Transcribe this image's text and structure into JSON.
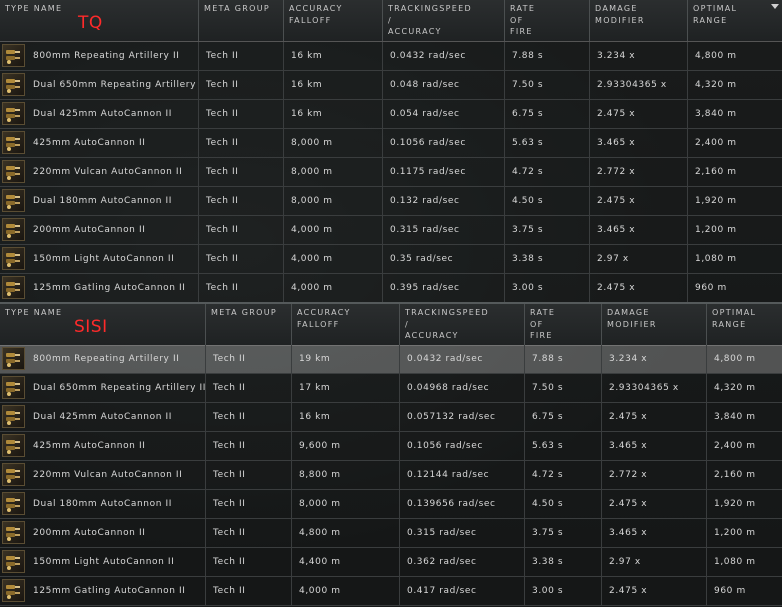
{
  "tables": [
    {
      "tag": "TQ",
      "headers": [
        [
          "TYPE NAME"
        ],
        [
          "META GROUP"
        ],
        [
          "ACCURACY",
          "FALLOFF"
        ],
        [
          "TRACKINGSPEED",
          "/",
          "ACCURACY"
        ],
        [
          "RATE",
          "OF",
          "FIRE"
        ],
        [
          "DAMAGE",
          "MODIFIER"
        ],
        [
          "OPTIMAL",
          "RANGE"
        ]
      ],
      "rows": [
        {
          "icon": "autocannon-ammo-icon",
          "name": "800mm Repeating Artillery II",
          "meta": "Tech II",
          "falloff": "16 km",
          "tracking": "0.0432 rad/sec",
          "rof": "7.88 s",
          "dmg": "3.234 x",
          "range": "4,800 m"
        },
        {
          "icon": "autocannon-ammo-icon",
          "name": "Dual 650mm Repeating Artillery",
          "meta": "Tech II",
          "falloff": "16 km",
          "tracking": "0.048 rad/sec",
          "rof": "7.50 s",
          "dmg": "2.93304365 x",
          "range": "4,320 m"
        },
        {
          "icon": "autocannon-ammo-icon",
          "name": "Dual 425mm AutoCannon II",
          "meta": "Tech II",
          "falloff": "16 km",
          "tracking": "0.054 rad/sec",
          "rof": "6.75 s",
          "dmg": "2.475 x",
          "range": "3,840 m"
        },
        {
          "icon": "autocannon-ammo-icon",
          "name": "425mm AutoCannon II",
          "meta": "Tech II",
          "falloff": "8,000 m",
          "tracking": "0.1056 rad/sec",
          "rof": "5.63 s",
          "dmg": "3.465 x",
          "range": "2,400 m"
        },
        {
          "icon": "autocannon-ammo-icon",
          "name": "220mm Vulcan AutoCannon II",
          "meta": "Tech II",
          "falloff": "8,000 m",
          "tracking": "0.1175 rad/sec",
          "rof": "4.72 s",
          "dmg": "2.772 x",
          "range": "2,160 m"
        },
        {
          "icon": "autocannon-ammo-icon",
          "name": "Dual 180mm AutoCannon II",
          "meta": "Tech II",
          "falloff": "8,000 m",
          "tracking": "0.132 rad/sec",
          "rof": "4.50 s",
          "dmg": "2.475 x",
          "range": "1,920 m"
        },
        {
          "icon": "autocannon-ammo-icon",
          "name": "200mm AutoCannon II",
          "meta": "Tech II",
          "falloff": "4,000 m",
          "tracking": "0.315 rad/sec",
          "rof": "3.75 s",
          "dmg": "3.465 x",
          "range": "1,200 m"
        },
        {
          "icon": "autocannon-ammo-icon",
          "name": "150mm Light AutoCannon II",
          "meta": "Tech II",
          "falloff": "4,000 m",
          "tracking": "0.35 rad/sec",
          "rof": "3.38 s",
          "dmg": "2.97 x",
          "range": "1,080 m"
        },
        {
          "icon": "autocannon-ammo-icon",
          "name": "125mm Gatling AutoCannon II",
          "meta": "Tech II",
          "falloff": "4,000 m",
          "tracking": "0.395 rad/sec",
          "rof": "3.00 s",
          "dmg": "2.475 x",
          "range": "960 m"
        }
      ]
    },
    {
      "tag": "SISI",
      "headers": [
        [
          "TYPE NAME"
        ],
        [
          "META GROUP"
        ],
        [
          "ACCURACY",
          "FALLOFF"
        ],
        [
          "TRACKINGSPEED",
          "/",
          "ACCURACY"
        ],
        [
          "RATE",
          "OF",
          "FIRE"
        ],
        [
          "DAMAGE",
          "MODIFIER"
        ],
        [
          "OPTIMAL",
          "RANGE"
        ]
      ],
      "rows": [
        {
          "icon": "autocannon-ammo-icon",
          "name": "800mm Repeating Artillery II",
          "meta": "Tech II",
          "falloff": "19 km",
          "tracking": "0.0432 rad/sec",
          "rof": "7.88 s",
          "dmg": "3.234 x",
          "range": "4,800 m"
        },
        {
          "icon": "autocannon-ammo-icon",
          "name": "Dual 650mm Repeating Artillery II",
          "meta": "Tech II",
          "falloff": "17 km",
          "tracking": "0.04968 rad/sec",
          "rof": "7.50 s",
          "dmg": "2.93304365 x",
          "range": "4,320 m"
        },
        {
          "icon": "autocannon-ammo-icon",
          "name": "Dual 425mm AutoCannon II",
          "meta": "Tech II",
          "falloff": "16 km",
          "tracking": "0.057132 rad/sec",
          "rof": "6.75 s",
          "dmg": "2.475 x",
          "range": "3,840 m"
        },
        {
          "icon": "autocannon-ammo-icon",
          "name": "425mm AutoCannon II",
          "meta": "Tech II",
          "falloff": "9,600 m",
          "tracking": "0.1056 rad/sec",
          "rof": "5.63 s",
          "dmg": "3.465 x",
          "range": "2,400 m"
        },
        {
          "icon": "autocannon-ammo-icon",
          "name": "220mm Vulcan AutoCannon II",
          "meta": "Tech II",
          "falloff": "8,800 m",
          "tracking": "0.12144 rad/sec",
          "rof": "4.72 s",
          "dmg": "2.772 x",
          "range": "2,160 m"
        },
        {
          "icon": "autocannon-ammo-icon",
          "name": "Dual 180mm AutoCannon II",
          "meta": "Tech II",
          "falloff": "8,000 m",
          "tracking": "0.139656 rad/sec",
          "rof": "4.50 s",
          "dmg": "2.475 x",
          "range": "1,920 m"
        },
        {
          "icon": "autocannon-ammo-icon",
          "name": "200mm AutoCannon II",
          "meta": "Tech II",
          "falloff": "4,800 m",
          "tracking": "0.315 rad/sec",
          "rof": "3.75 s",
          "dmg": "3.465 x",
          "range": "1,200 m"
        },
        {
          "icon": "autocannon-ammo-icon",
          "name": "150mm Light AutoCannon II",
          "meta": "Tech II",
          "falloff": "4,400 m",
          "tracking": "0.362 rad/sec",
          "rof": "3.38 s",
          "dmg": "2.97 x",
          "range": "1,080 m"
        },
        {
          "icon": "autocannon-ammo-icon",
          "name": "125mm Gatling AutoCannon II",
          "meta": "Tech II",
          "falloff": "4,000 m",
          "tracking": "0.417 rad/sec",
          "rof": "3.00 s",
          "dmg": "2.475 x",
          "range": "960 m"
        }
      ]
    }
  ],
  "colors": {
    "tag": "#ff2a2a",
    "highlight_row": "#8c8c8c"
  }
}
